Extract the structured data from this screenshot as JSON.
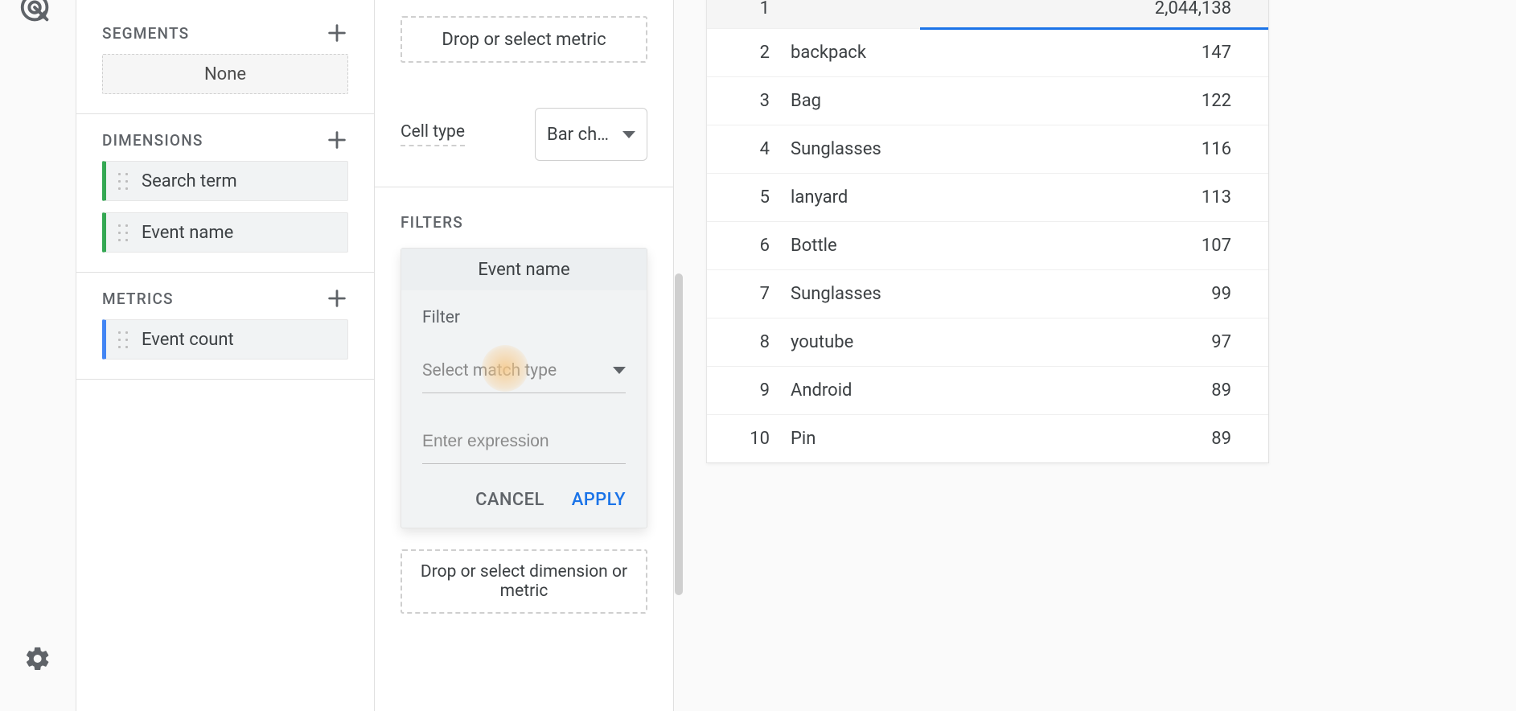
{
  "segments": {
    "title": "SEGMENTS",
    "placeholder": "None"
  },
  "dimensions": {
    "title": "DIMENSIONS",
    "items": [
      "Search term",
      "Event name"
    ]
  },
  "metrics": {
    "title": "METRICS",
    "items": [
      "Event count"
    ]
  },
  "drop_metric_label": "Drop or select metric",
  "cell_type": {
    "label": "Cell type",
    "value": "Bar ch…"
  },
  "filters": {
    "title": "FILTERS",
    "chip": "Event name",
    "label": "Filter",
    "match_placeholder": "Select match type",
    "expr_placeholder": "Enter expression",
    "cancel": "CANCEL",
    "apply": "APPLY"
  },
  "drop_dim_metric_label": "Drop or select dimension or metric",
  "table": {
    "header_value": "2,044,138",
    "rows": [
      {
        "n": "1",
        "term": "",
        "value": ""
      },
      {
        "n": "2",
        "term": "backpack",
        "value": "147"
      },
      {
        "n": "3",
        "term": "Bag",
        "value": "122"
      },
      {
        "n": "4",
        "term": "Sunglasses",
        "value": "116"
      },
      {
        "n": "5",
        "term": "lanyard",
        "value": "113"
      },
      {
        "n": "6",
        "term": "Bottle",
        "value": "107"
      },
      {
        "n": "7",
        "term": "Sunglasses",
        "value": "99"
      },
      {
        "n": "8",
        "term": "youtube",
        "value": "97"
      },
      {
        "n": "9",
        "term": "Android",
        "value": "89"
      },
      {
        "n": "10",
        "term": "Pin",
        "value": "89"
      }
    ]
  }
}
